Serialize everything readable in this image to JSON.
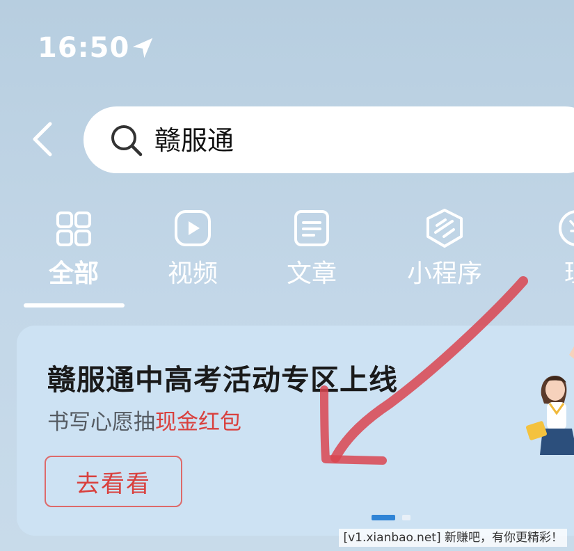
{
  "status_bar": {
    "time": "16:50"
  },
  "search": {
    "query": "赣服通"
  },
  "tabs": [
    {
      "label": "全部",
      "icon": "grid-icon",
      "active": true
    },
    {
      "label": "视频",
      "icon": "play-icon",
      "active": false
    },
    {
      "label": "文章",
      "icon": "article-icon",
      "active": false
    },
    {
      "label": "小程序",
      "icon": "mini-program-icon",
      "active": false
    },
    {
      "label": "理",
      "icon": "finance-icon",
      "active": false
    }
  ],
  "banner": {
    "title": "赣服通中高考活动专区上线",
    "subtitle_prefix": "书写心愿抽",
    "subtitle_highlight": "现金红包",
    "button_label": "去看看"
  },
  "carousel": {
    "count": 2,
    "active_index": 0
  },
  "watermark": "[v1.xianbao.net] 新赚吧，有你更精彩！",
  "colors": {
    "accent_red": "#d9403d",
    "indicator_blue": "#2f84d6",
    "annotation_red": "#d94550"
  }
}
